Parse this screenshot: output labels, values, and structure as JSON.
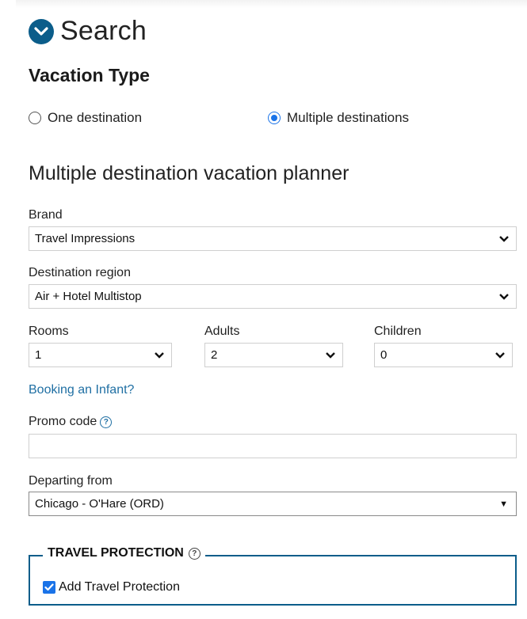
{
  "header": {
    "title": "Search",
    "icon": "chevron-down-circle-icon"
  },
  "vacation_type": {
    "title": "Vacation Type",
    "options": [
      {
        "label": "One destination",
        "selected": false
      },
      {
        "label": "Multiple destinations",
        "selected": true
      }
    ]
  },
  "planner": {
    "title": "Multiple destination vacation planner"
  },
  "brand": {
    "label": "Brand",
    "value": "Travel Impressions"
  },
  "region": {
    "label": "Destination region",
    "value": "Air + Hotel Multistop"
  },
  "rooms": {
    "label": "Rooms",
    "value": "1"
  },
  "adults": {
    "label": "Adults",
    "value": "2"
  },
  "children": {
    "label": "Children",
    "value": "0"
  },
  "infant_link": "Booking an Infant?",
  "promo": {
    "label": "Promo code",
    "value": ""
  },
  "departing": {
    "label": "Departing from",
    "value": "Chicago - O'Hare (ORD)"
  },
  "protection": {
    "legend": "TRAVEL PROTECTION",
    "checkbox_label": "Add Travel Protection",
    "checked": true
  },
  "colors": {
    "accent": "#0b5d8a",
    "link": "#1f6fa3",
    "radio": "#1a73e8"
  }
}
